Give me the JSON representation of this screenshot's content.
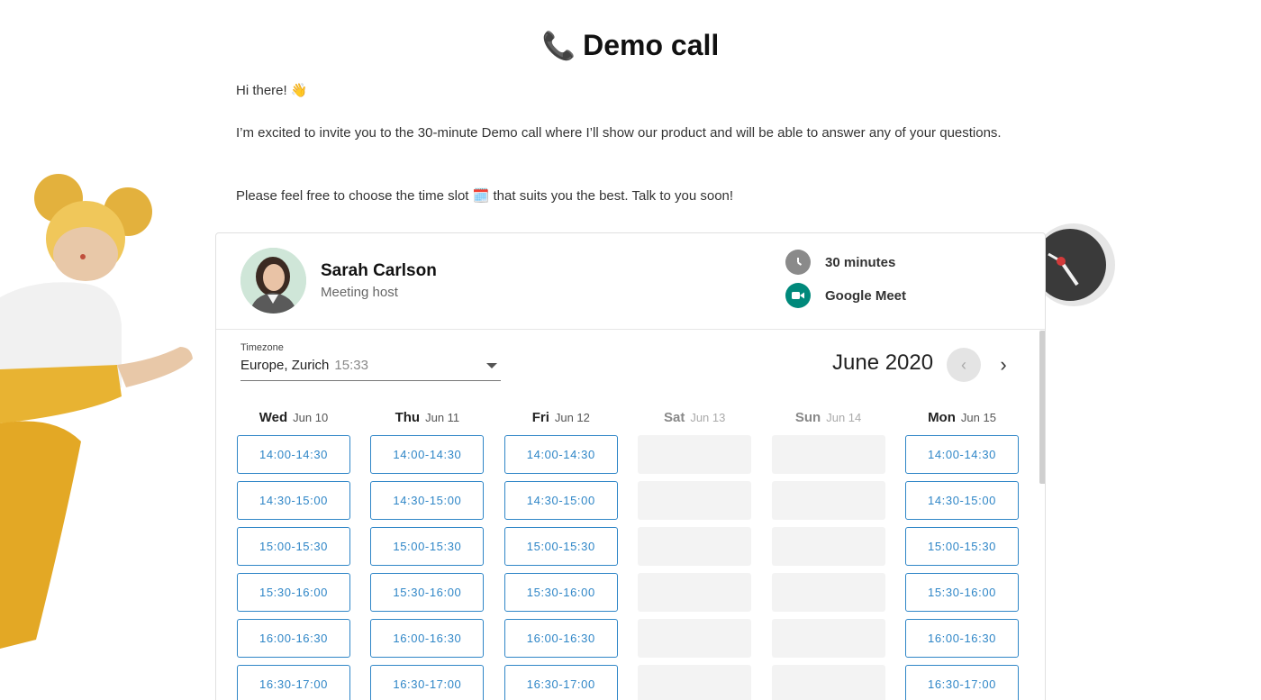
{
  "header": {
    "title": "Demo call",
    "title_icon": "phone-icon"
  },
  "intro": {
    "greeting": "Hi there!",
    "greeting_emoji": "👋",
    "paragraph": "I’m excited to invite you to the 30-minute Demo call where I’ll show our product and will be able to answer any of your questions.",
    "choose_before": "Please feel free to choose the time slot",
    "choose_emoji": "🗓️",
    "choose_after": "that suits you the best. Talk to you soon!"
  },
  "host": {
    "name": "Sarah Carlson",
    "role": "Meeting host",
    "avatar_icon": "person-avatar"
  },
  "meeting": {
    "duration": "30 minutes",
    "duration_icon": "clock-icon",
    "platform": "Google Meet",
    "platform_icon": "google-meet-icon"
  },
  "timezone": {
    "label": "Timezone",
    "value": "Europe, Zurich",
    "time": "15:33"
  },
  "calendar": {
    "month": "June 2020",
    "prev_label": "‹",
    "next_label": "›",
    "days": [
      {
        "name": "Wed",
        "date": "Jun 10",
        "available": true,
        "slots": [
          "14:00-14:30",
          "14:30-15:00",
          "15:00-15:30",
          "15:30-16:00",
          "16:00-16:30",
          "16:30-17:00"
        ]
      },
      {
        "name": "Thu",
        "date": "Jun 11",
        "available": true,
        "slots": [
          "14:00-14:30",
          "14:30-15:00",
          "15:00-15:30",
          "15:30-16:00",
          "16:00-16:30",
          "16:30-17:00"
        ]
      },
      {
        "name": "Fri",
        "date": "Jun 12",
        "available": true,
        "slots": [
          "14:00-14:30",
          "14:30-15:00",
          "15:00-15:30",
          "15:30-16:00",
          "16:00-16:30",
          "16:30-17:00"
        ]
      },
      {
        "name": "Sat",
        "date": "Jun 13",
        "available": false,
        "slots": [
          "",
          "",
          "",
          "",
          "",
          ""
        ]
      },
      {
        "name": "Sun",
        "date": "Jun 14",
        "available": false,
        "slots": [
          "",
          "",
          "",
          "",
          "",
          ""
        ]
      },
      {
        "name": "Mon",
        "date": "Jun 15",
        "available": true,
        "slots": [
          "14:00-14:30",
          "14:30-15:00",
          "15:00-15:30",
          "15:30-16:00",
          "16:00-16:30",
          "16:30-17:00"
        ]
      }
    ]
  },
  "colors": {
    "accent": "#2f86c7",
    "meet_green": "#00897b",
    "clock_gray": "#8a8a8a"
  }
}
